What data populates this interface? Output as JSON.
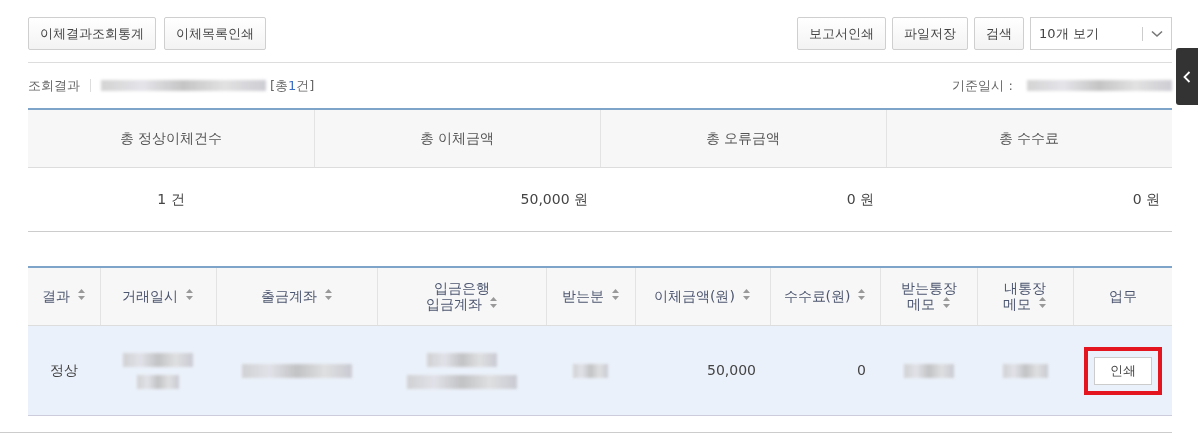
{
  "toolbar": {
    "left_buttons": [
      "이체결과조회통계",
      "이체목록인쇄"
    ],
    "right_buttons": [
      "보고서인쇄",
      "파일저장",
      "검색"
    ],
    "page_size_select": {
      "value": "10개 보기"
    }
  },
  "result_info": {
    "label": "조회결과",
    "period": {
      "kind": "redacted"
    },
    "total": {
      "prefix": "[총",
      "count": "1",
      "suffix": "건]"
    },
    "base_time_label": "기준일시 :",
    "base_time": {
      "kind": "redacted"
    }
  },
  "summary": {
    "columns": [
      "총 정상이체건수",
      "총 이체금액",
      "총 오류금액",
      "총 수수료"
    ],
    "values": [
      {
        "kind": "count",
        "text": "1 건"
      },
      {
        "kind": "amount",
        "text": "50,000 원"
      },
      {
        "kind": "amount",
        "text": "0 원"
      },
      {
        "kind": "amount",
        "text": "0 원"
      }
    ]
  },
  "table": {
    "columns": [
      {
        "label": "결과",
        "sortable": true
      },
      {
        "label": "거래일시",
        "sortable": true
      },
      {
        "label": "출금계좌",
        "sortable": true
      },
      {
        "label": "입금은행\n입금계좌",
        "sortable": true
      },
      {
        "label": "받는분",
        "sortable": true
      },
      {
        "label": "이체금액(원)",
        "sortable": true
      },
      {
        "label": "수수료(원)",
        "sortable": true
      },
      {
        "label": "받는통장\n메모",
        "sortable": true
      },
      {
        "label": "내통장\n메모",
        "sortable": true
      },
      {
        "label": "업무",
        "sortable": false
      }
    ],
    "rows": [
      {
        "selected": true,
        "cells": [
          {
            "kind": "text",
            "text": "정상"
          },
          {
            "kind": "redacted-2line"
          },
          {
            "kind": "redacted"
          },
          {
            "kind": "redacted-2line"
          },
          {
            "kind": "redacted"
          },
          {
            "kind": "amount",
            "text": "50,000"
          },
          {
            "kind": "amount",
            "text": "0"
          },
          {
            "kind": "redacted"
          },
          {
            "kind": "redacted"
          },
          {
            "kind": "button",
            "text": "인쇄",
            "highlighted": true
          }
        ]
      }
    ]
  },
  "side_panel_toggle": {
    "collapsed": true
  }
}
